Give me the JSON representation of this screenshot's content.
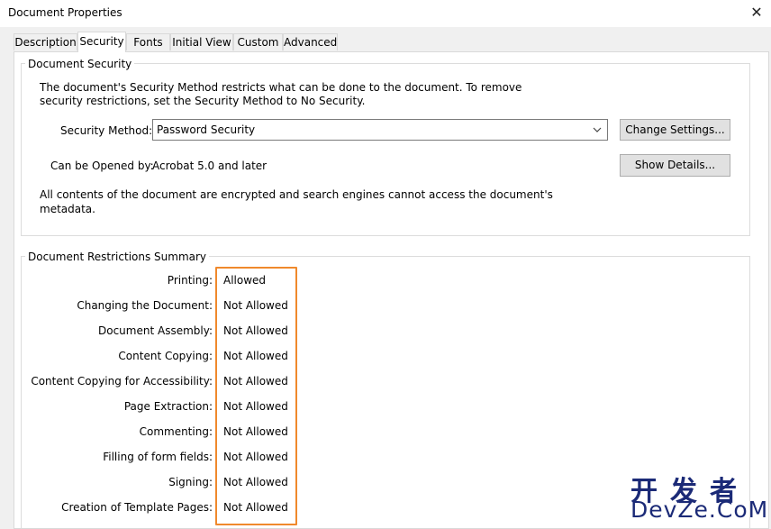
{
  "window": {
    "title": "Document Properties"
  },
  "tabs": [
    {
      "label": "Description"
    },
    {
      "label": "Security"
    },
    {
      "label": "Fonts"
    },
    {
      "label": "Initial View"
    },
    {
      "label": "Custom"
    },
    {
      "label": "Advanced"
    }
  ],
  "document_security": {
    "group_label": "Document Security",
    "intro_line1": "The document's Security Method restricts what can be done to the document. To remove",
    "intro_line2": "security restrictions, set the Security Method to No Security.",
    "security_method_label": "Security Method:",
    "security_method_value": "Password Security",
    "change_settings_label": "Change Settings...",
    "opened_by_label": "Can be Opened by:",
    "opened_by_value": "Acrobat 5.0 and later",
    "show_details_label": "Show Details...",
    "encrypted_line1": "All contents of the document are encrypted and search engines cannot access the document's",
    "encrypted_line2": "metadata."
  },
  "restrictions": {
    "group_label": "Document Restrictions Summary",
    "rows": [
      {
        "label": "Printing:",
        "value": "Allowed"
      },
      {
        "label": "Changing the Document:",
        "value": "Not Allowed"
      },
      {
        "label": "Document Assembly:",
        "value": "Not Allowed"
      },
      {
        "label": "Content Copying:",
        "value": "Not Allowed"
      },
      {
        "label": "Content Copying for Accessibility:",
        "value": "Not Allowed"
      },
      {
        "label": "Page Extraction:",
        "value": "Not Allowed"
      },
      {
        "label": "Commenting:",
        "value": "Not Allowed"
      },
      {
        "label": "Filling of form fields:",
        "value": "Not Allowed"
      },
      {
        "label": "Signing:",
        "value": "Not Allowed"
      },
      {
        "label": "Creation of Template Pages:",
        "value": "Not Allowed"
      }
    ]
  },
  "watermark": {
    "cn": "开发者",
    "en": "DevZe.CoM"
  },
  "colors": {
    "highlight": "#f0892c",
    "watermark": "#1b2a77"
  }
}
